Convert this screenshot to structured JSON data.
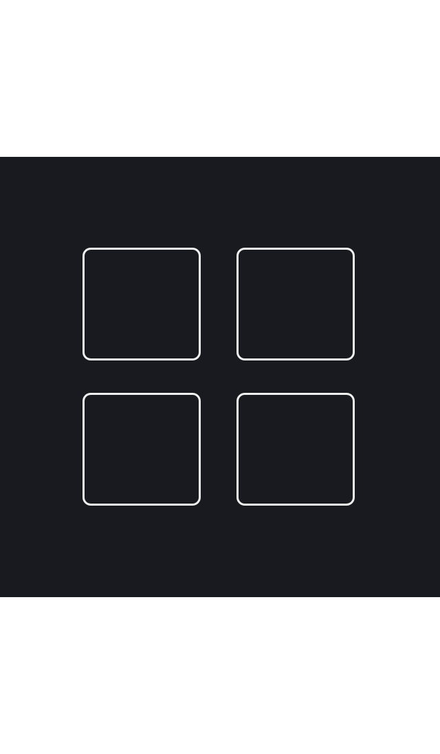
{
  "image": {
    "icon": "grid-icon",
    "background_color": "#181a1f",
    "stroke_color": "#f2f2f2",
    "tiles": [
      {
        "position": "top-left"
      },
      {
        "position": "top-right"
      },
      {
        "position": "bottom-left"
      },
      {
        "position": "bottom-right"
      }
    ]
  }
}
